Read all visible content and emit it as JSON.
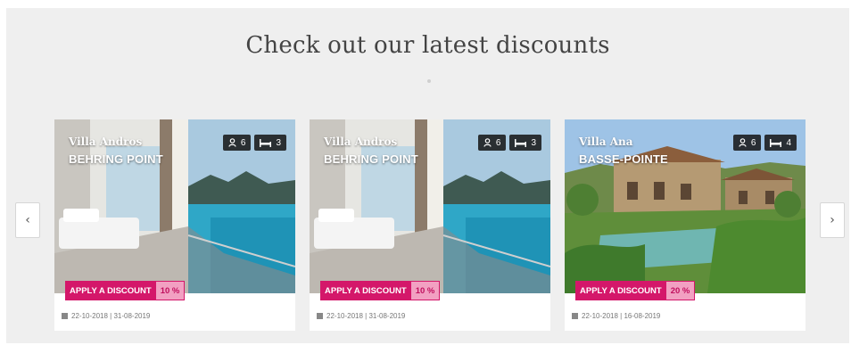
{
  "section": {
    "heading": "Check out our latest discounts"
  },
  "nav": {
    "prev_icon": "chevron-left-icon",
    "next_icon": "chevron-right-icon",
    "prev_glyph": "‹",
    "next_glyph": "›"
  },
  "colors": {
    "accent": "#d4176a",
    "accent_light": "#f2a0c2",
    "background": "#efefef"
  },
  "cards": [
    {
      "villa_name": "Villa Andros",
      "location": "BEHRING POINT",
      "guests": "6",
      "beds": "3",
      "discount_label": "APPLY A DISCOUNT",
      "discount_value": "10 %",
      "dates": "22-10-2018 | 31-08-2019",
      "image": "balcony-sea-view"
    },
    {
      "villa_name": "Villa Andros",
      "location": "BEHRING POINT",
      "guests": "6",
      "beds": "3",
      "discount_label": "APPLY A DISCOUNT",
      "discount_value": "10 %",
      "dates": "22-10-2018 | 31-08-2019",
      "image": "balcony-sea-view"
    },
    {
      "villa_name": "Villa Ana",
      "location": "BASSE-POINTE",
      "guests": "6",
      "beds": "4",
      "discount_label": "APPLY A DISCOUNT",
      "discount_value": "20 %",
      "dates": "22-10-2018 | 16-08-2019",
      "image": "villa-with-pool"
    }
  ]
}
